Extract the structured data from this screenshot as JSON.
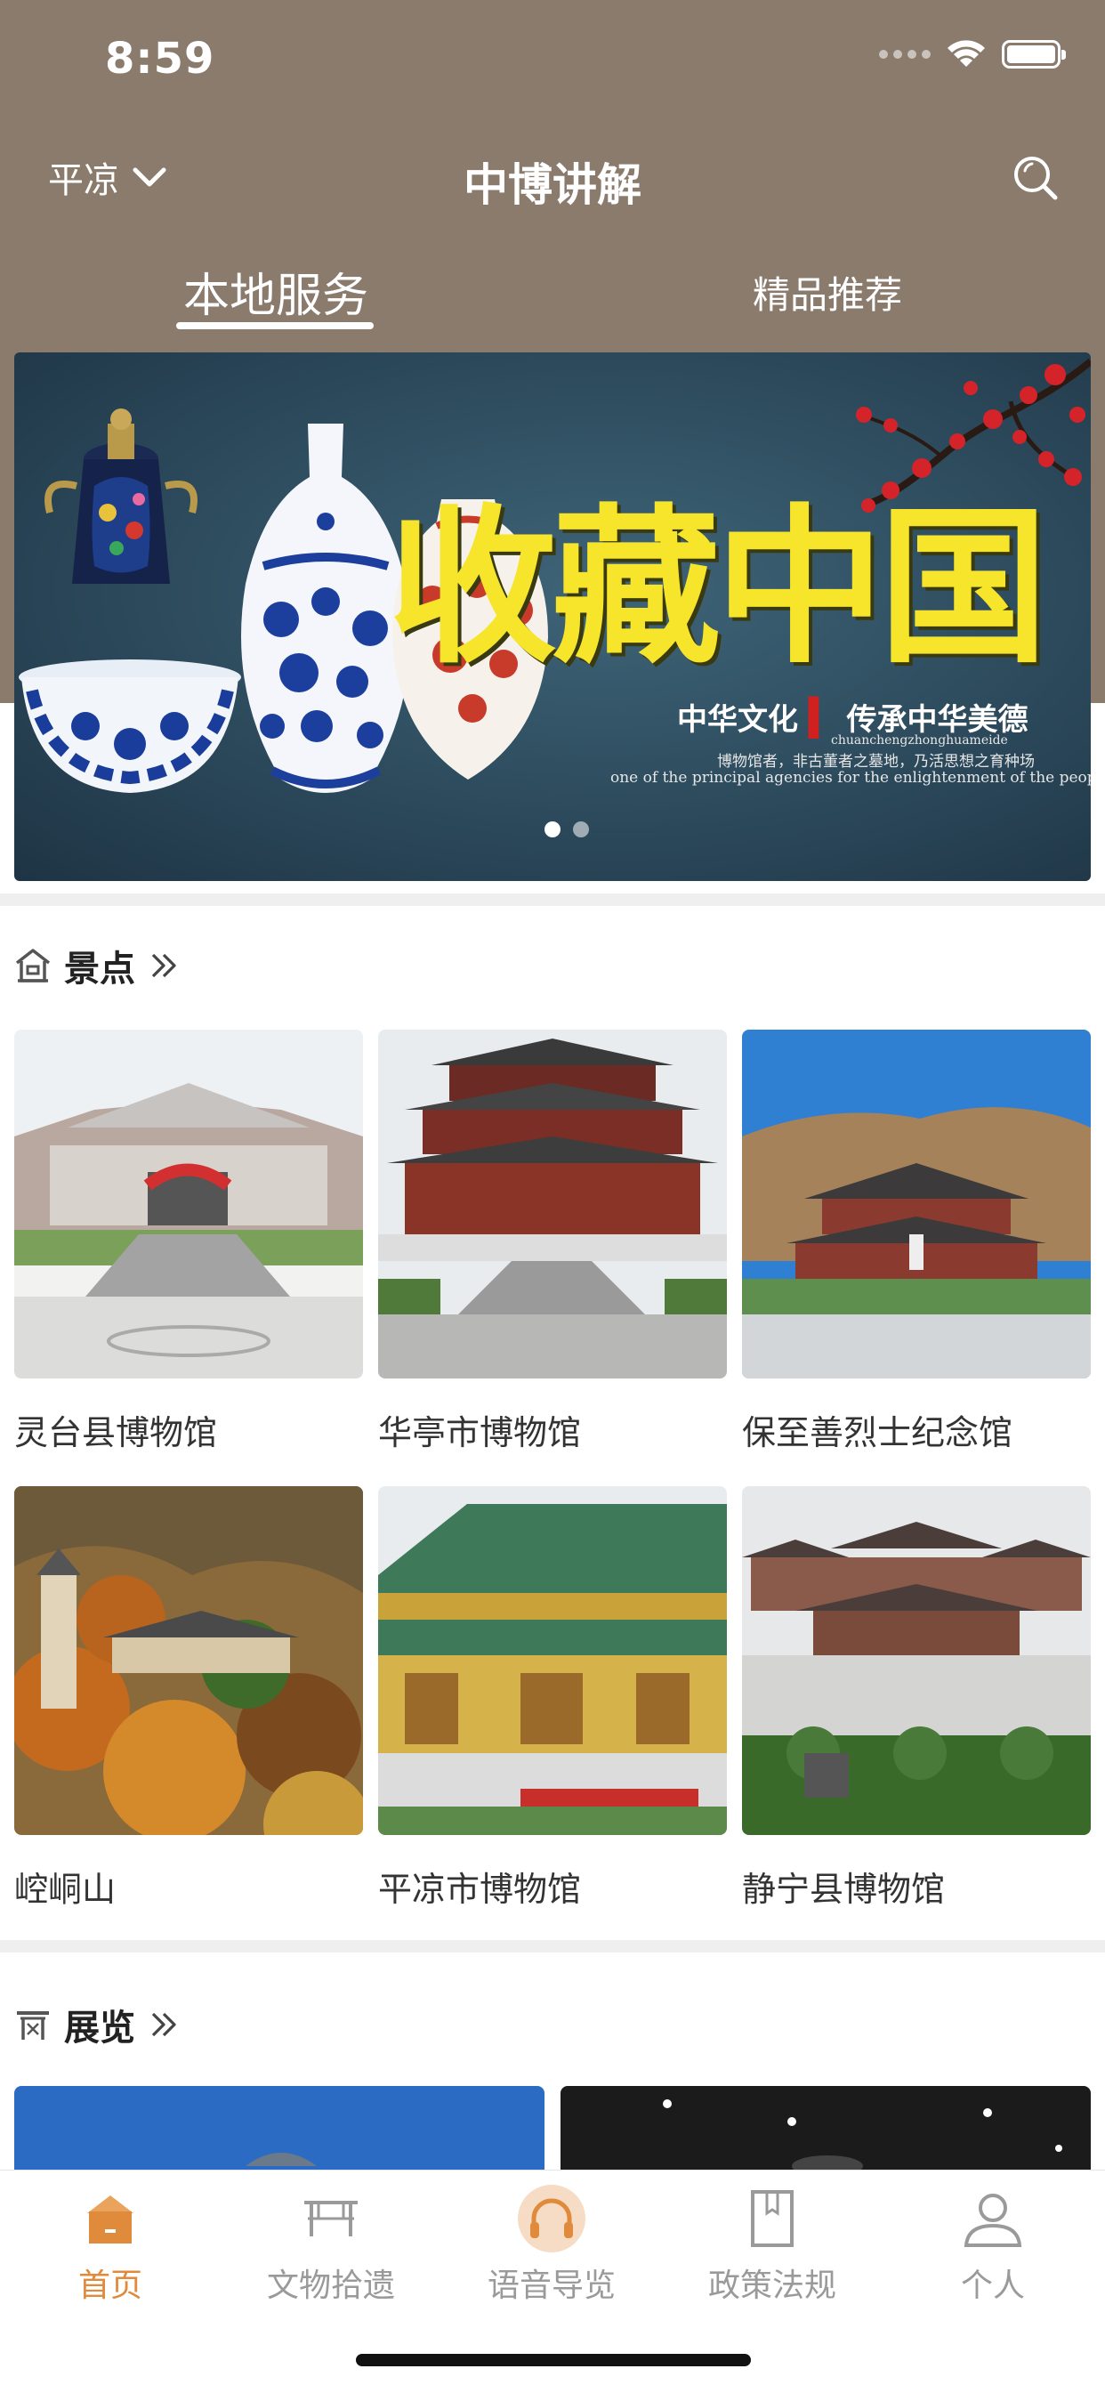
{
  "status": {
    "time": "8:59"
  },
  "header": {
    "city": "平凉",
    "title": "中博讲解",
    "tabs": [
      {
        "label": "本地服务",
        "active": true
      },
      {
        "label": "精品推荐",
        "active": false
      }
    ]
  },
  "banner": {
    "title": "收藏中国",
    "subtitle_left": "中华文化",
    "subtitle_right": "传承中华美德",
    "pinyin": "chuanchengzhonghuameide",
    "line_cn": "博物馆者，非古董者之墓地，乃活思想之育种场",
    "line_en": "one of the principal agencies for the enlightenment of the people.",
    "pages": 2,
    "current_page": 1
  },
  "sections": {
    "scenic": {
      "title": "景点",
      "icon": "pavilion-icon",
      "items": [
        {
          "name": "灵台县博物馆"
        },
        {
          "name": "华亭市博物馆"
        },
        {
          "name": "保至善烈士纪念馆"
        },
        {
          "name": "崆峒山"
        },
        {
          "name": "平凉市博物馆"
        },
        {
          "name": "静宁县博物馆"
        }
      ]
    },
    "exhibition": {
      "title": "展览",
      "icon": "gate-icon"
    }
  },
  "tabbar": {
    "items": [
      {
        "label": "首页",
        "icon": "home-icon",
        "active": true
      },
      {
        "label": "文物拾遗",
        "icon": "artifact-cart-icon",
        "active": false
      },
      {
        "label": "语音导览",
        "icon": "headphones-icon",
        "active": false
      },
      {
        "label": "政策法规",
        "icon": "document-icon",
        "active": false
      },
      {
        "label": "个人",
        "icon": "person-icon",
        "active": false
      }
    ]
  },
  "colors": {
    "header_bg": "#8a7b6d",
    "accent": "#e08a3c",
    "inactive": "#9a9a9a"
  }
}
